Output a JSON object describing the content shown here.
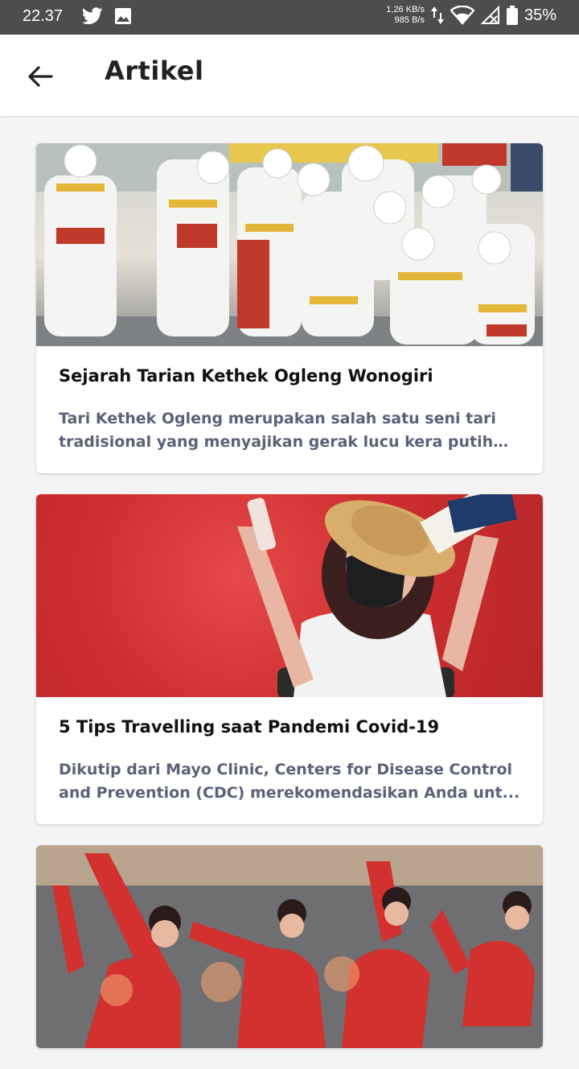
{
  "status_bar": {
    "time": "22.37",
    "speed_up": "1,26 KB/s",
    "speed_down": "985 B/s",
    "battery": "35%"
  },
  "appbar": {
    "title": "Artikel"
  },
  "articles": [
    {
      "title": "Sejarah Tarian Kethek Ogleng Wonogiri",
      "desc": "Tari Kethek Ogleng merupakan salah satu seni tari tradisional yang menyajikan gerak lucu kera putih d..."
    },
    {
      "title": "5 Tips Travelling saat Pandemi Covid-19",
      "desc": "Dikutip dari Mayo Clinic, Centers for Disease Control and Prevention (CDC) merekomendasikan Anda unt..."
    }
  ],
  "colors": {
    "status_bar": "#4d4d4d",
    "desc_text": "#5b6178",
    "card_bg": "#ffffff",
    "page_bg": "#f4f4f4"
  }
}
